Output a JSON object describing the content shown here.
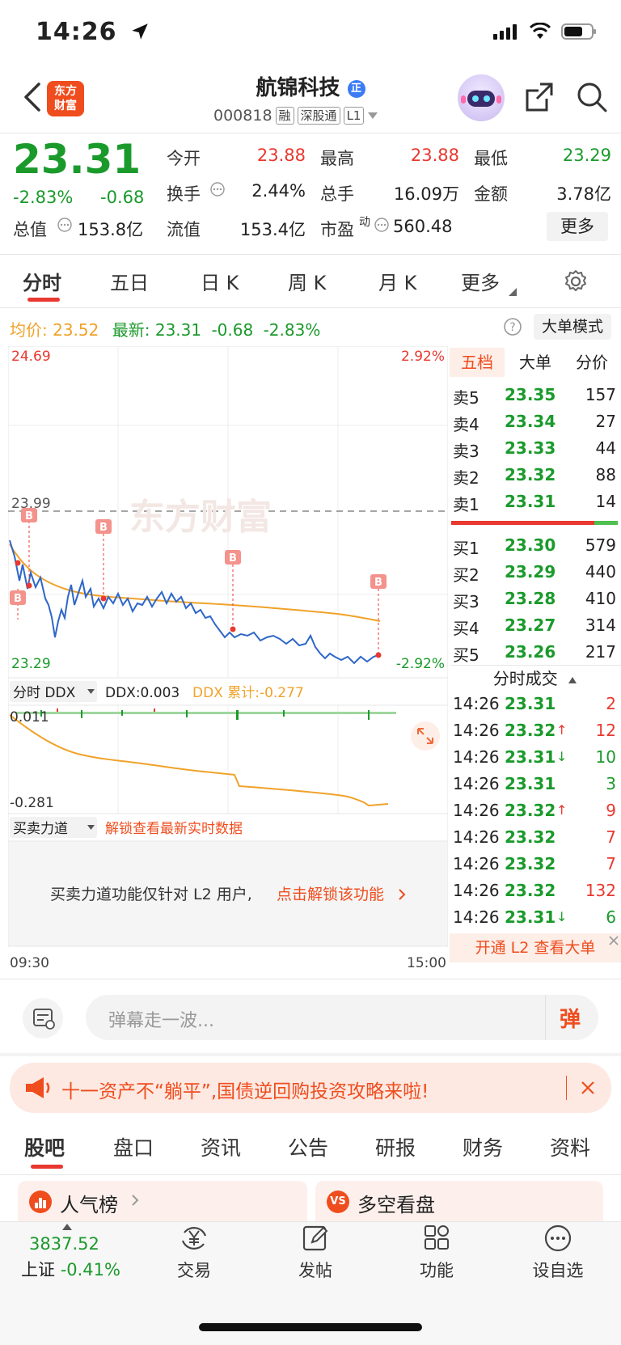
{
  "status_bar": {
    "time": "14:26"
  },
  "header": {
    "app_logo": "东方财富",
    "stock_name": "航锦科技",
    "stock_code": "000818",
    "tags": [
      "融",
      "深股通",
      "L1"
    ]
  },
  "quote": {
    "price": "23.31",
    "change_pct": "-2.83%",
    "change_abs": "-0.68",
    "fields": [
      {
        "label": "今开",
        "value": "23.88",
        "color": "#e8382f"
      },
      {
        "label": "最高",
        "value": "23.88",
        "color": "#e8382f"
      },
      {
        "label": "最低",
        "value": "23.29",
        "color": "#1b9a2c"
      },
      {
        "label": "换手",
        "value": "2.44%",
        "color": "#222222"
      },
      {
        "label": "总手",
        "value": "16.09万",
        "color": "#222222"
      },
      {
        "label": "金额",
        "value": "3.78亿",
        "color": "#222222"
      },
      {
        "label": "总值",
        "value": "153.8亿",
        "color": "#222222"
      },
      {
        "label": "流值",
        "value": "153.4亿",
        "color": "#222222"
      },
      {
        "label": "市盈",
        "value": "560.48",
        "color": "#222222"
      }
    ],
    "pe_superscript": "动",
    "more_button": "更多"
  },
  "chart_tabs": [
    "分时",
    "五日",
    "日 K",
    "周 K",
    "月 K",
    "更多"
  ],
  "active_tab": "分时",
  "info_row": {
    "avg_label": "均价:",
    "avg_value": "23.52",
    "latest_label": "最新:",
    "latest_price": "23.31",
    "latest_change": "-0.68",
    "latest_pct": "-2.83%",
    "big_order_mode": "大单模式"
  },
  "chart": {
    "y_top": "24.69",
    "y_top_pct": "2.92%",
    "y_mid": "23.99",
    "y_bottom": "23.29",
    "y_bottom_pct": "-2.92%",
    "x_start": "09:30",
    "x_end": "15:00",
    "watermark": "东方财富",
    "marker_label": "B"
  },
  "ddx": {
    "selector": "分时 DDX",
    "ddx_label": "DDX:0.003",
    "ddx_cum_label": "DDX 累计:-0.277",
    "y_top": "0.011",
    "y_bottom": "-0.281"
  },
  "force": {
    "selector": "买卖力道",
    "unlock_hint": "解锁查看最新实时数据",
    "notice": "买卖力道功能仅针对 L2 用户,",
    "notice_link": "点击解锁该功能"
  },
  "orderbook": {
    "tabs": [
      "五档",
      "大单",
      "分价"
    ],
    "asks": [
      {
        "label": "卖5",
        "price": "23.35",
        "vol": "157"
      },
      {
        "label": "卖4",
        "price": "23.34",
        "vol": "27"
      },
      {
        "label": "卖3",
        "price": "23.33",
        "vol": "44"
      },
      {
        "label": "卖2",
        "price": "23.32",
        "vol": "88"
      },
      {
        "label": "卖1",
        "price": "23.31",
        "vol": "14"
      }
    ],
    "bids": [
      {
        "label": "买1",
        "price": "23.30",
        "vol": "579"
      },
      {
        "label": "买2",
        "price": "23.29",
        "vol": "440"
      },
      {
        "label": "买3",
        "price": "23.28",
        "vol": "410"
      },
      {
        "label": "买4",
        "price": "23.27",
        "vol": "314"
      },
      {
        "label": "买5",
        "price": "23.26",
        "vol": "217"
      }
    ],
    "ticks_title": "分时成交",
    "ticks": [
      {
        "time": "14:26",
        "price": "23.31",
        "arrow": "",
        "vol": "2",
        "color": "#e8382f"
      },
      {
        "time": "14:26",
        "price": "23.32",
        "arrow": "↑",
        "vol": "12",
        "color": "#e8382f"
      },
      {
        "time": "14:26",
        "price": "23.31",
        "arrow": "↓",
        "vol": "10",
        "color": "#1b9a2c"
      },
      {
        "time": "14:26",
        "price": "23.31",
        "arrow": "",
        "vol": "3",
        "color": "#1b9a2c"
      },
      {
        "time": "14:26",
        "price": "23.32",
        "arrow": "↑",
        "vol": "9",
        "color": "#e8382f"
      },
      {
        "time": "14:26",
        "price": "23.32",
        "arrow": "",
        "vol": "7",
        "color": "#e8382f"
      },
      {
        "time": "14:26",
        "price": "23.32",
        "arrow": "",
        "vol": "7",
        "color": "#e8382f"
      },
      {
        "time": "14:26",
        "price": "23.32",
        "arrow": "",
        "vol": "132",
        "color": "#e8382f"
      },
      {
        "time": "14:26",
        "price": "23.31",
        "arrow": "↓",
        "vol": "6",
        "color": "#1b9a2c"
      }
    ],
    "l2_banner": "开通 L2 查看大单"
  },
  "danmaku": {
    "placeholder": "弹幕走一波...",
    "send": "弹"
  },
  "banner": {
    "text": "十一资产不“躺平”,国债逆回购投资攻略来啦!"
  },
  "bottom_tabs": [
    "股吧",
    "盘口",
    "资讯",
    "公告",
    "研报",
    "财务",
    "资料"
  ],
  "cards": [
    {
      "label": "人气榜",
      "icon": "ranking-icon"
    },
    {
      "label": "多空看盘",
      "icon": "vs-icon"
    }
  ],
  "bottom_nav": {
    "index_value": "3837.52",
    "index_name": "上证",
    "index_pct": "-0.41%",
    "items": [
      "交易",
      "发帖",
      "功能",
      "设自选"
    ]
  }
}
